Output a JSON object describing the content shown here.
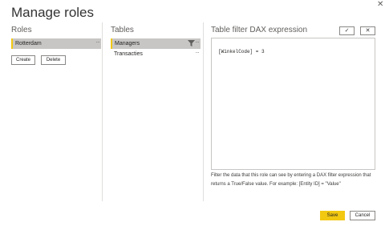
{
  "dialog": {
    "title": "Manage roles"
  },
  "roles": {
    "heading": "Roles",
    "items": [
      {
        "label": "Rotterdam",
        "selected": true
      }
    ],
    "create_label": "Create",
    "delete_label": "Delete"
  },
  "tables": {
    "heading": "Tables",
    "items": [
      {
        "label": "Managers",
        "selected": true
      },
      {
        "label": "Transacties",
        "selected": false
      }
    ]
  },
  "dax": {
    "heading": "Table filter DAX expression",
    "expression": "[WinkelCode] = 3",
    "help": "Filter the data that this role can see by entering a DAX filter expression that returns a True/False value. For example: [Entity ID] = \"Value\"",
    "check_icon": "✓",
    "cancel_icon": "✕"
  },
  "footer": {
    "save_label": "Save",
    "cancel_label": "Cancel"
  },
  "icons": {
    "more": "...",
    "close": "✕"
  },
  "colors": {
    "accent": "#f2c811",
    "selected_bg": "#c8c6c4"
  }
}
